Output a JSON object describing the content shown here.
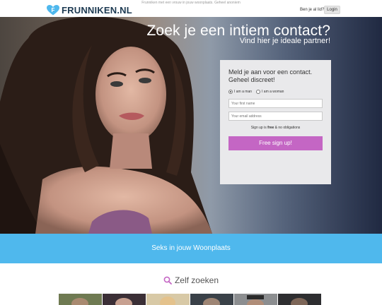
{
  "header": {
    "tagline": "Frunniken met een vrouw in jouw woonplaats. Geheel anoniem",
    "logo_text": "FRUNNIKEN.NL",
    "logo_letter": "F",
    "member_question": "Ben je al lid?",
    "login_label": "Login"
  },
  "hero": {
    "title": "Zoek je een intiem contact?",
    "subtitle": "Vind hier je ideale partner!"
  },
  "signup": {
    "title": "Meld je aan voor een contact. Geheel discreet!",
    "gender_man": "I am a man",
    "gender_woman": "I am a woman",
    "selected_gender": "man",
    "name_placeholder": "Your first name",
    "email_placeholder": "Your email address",
    "free_note_prefix": "Sign up is ",
    "free_note_bold": "free",
    "free_note_suffix": " & no obligations",
    "button_label": "Free sign up!"
  },
  "banner": {
    "text": "Seks in jouw Woonplaats"
  },
  "search": {
    "heading": "Zelf zoeken"
  },
  "colors": {
    "brand_dark": "#1d3a52",
    "heart": "#4fb8ed",
    "banner": "#4fb8ed",
    "signup_button": "#c466c4",
    "search_icon": "#c466c4"
  },
  "thumbnails": [
    {
      "name": "profile-photo-1"
    },
    {
      "name": "profile-photo-2"
    },
    {
      "name": "profile-photo-3"
    },
    {
      "name": "profile-photo-4"
    },
    {
      "name": "profile-photo-5"
    },
    {
      "name": "profile-photo-6"
    }
  ]
}
